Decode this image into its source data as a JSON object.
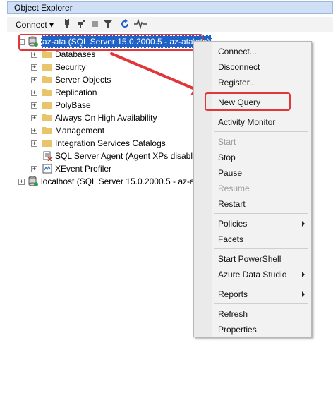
{
  "panel": {
    "title": "Object Explorer"
  },
  "toolbar": {
    "connect_label": "Connect ▾"
  },
  "tree": {
    "server1": "az-ata (SQL Server 15.0.2000.5 - az-ata\\ata)",
    "children": [
      "Databases",
      "Security",
      "Server Objects",
      "Replication",
      "PolyBase",
      "Always On High Availability",
      "Management",
      "Integration Services Catalogs",
      "SQL Server Agent (Agent XPs disabled)",
      "XEvent Profiler"
    ],
    "server2": "localhost (SQL Server 15.0.2000.5 - az-ata\\ata)"
  },
  "menu": {
    "items": [
      {
        "label": "Connect...",
        "enabled": true
      },
      {
        "label": "Disconnect",
        "enabled": true
      },
      {
        "label": "Register...",
        "enabled": true
      },
      {
        "label": "New Query",
        "enabled": true
      },
      {
        "label": "Activity Monitor",
        "enabled": true
      },
      {
        "label": "Start",
        "enabled": false
      },
      {
        "label": "Stop",
        "enabled": true
      },
      {
        "label": "Pause",
        "enabled": true
      },
      {
        "label": "Resume",
        "enabled": false
      },
      {
        "label": "Restart",
        "enabled": true
      },
      {
        "label": "Policies",
        "enabled": true,
        "submenu": true
      },
      {
        "label": "Facets",
        "enabled": true
      },
      {
        "label": "Start PowerShell",
        "enabled": true
      },
      {
        "label": "Azure Data Studio",
        "enabled": true,
        "submenu": true
      },
      {
        "label": "Reports",
        "enabled": true,
        "submenu": true
      },
      {
        "label": "Refresh",
        "enabled": true
      },
      {
        "label": "Properties",
        "enabled": true
      }
    ]
  },
  "colors": {
    "selection": "#1e62c8",
    "highlight_box": "#e0383a",
    "folder": "#e8c46a"
  }
}
